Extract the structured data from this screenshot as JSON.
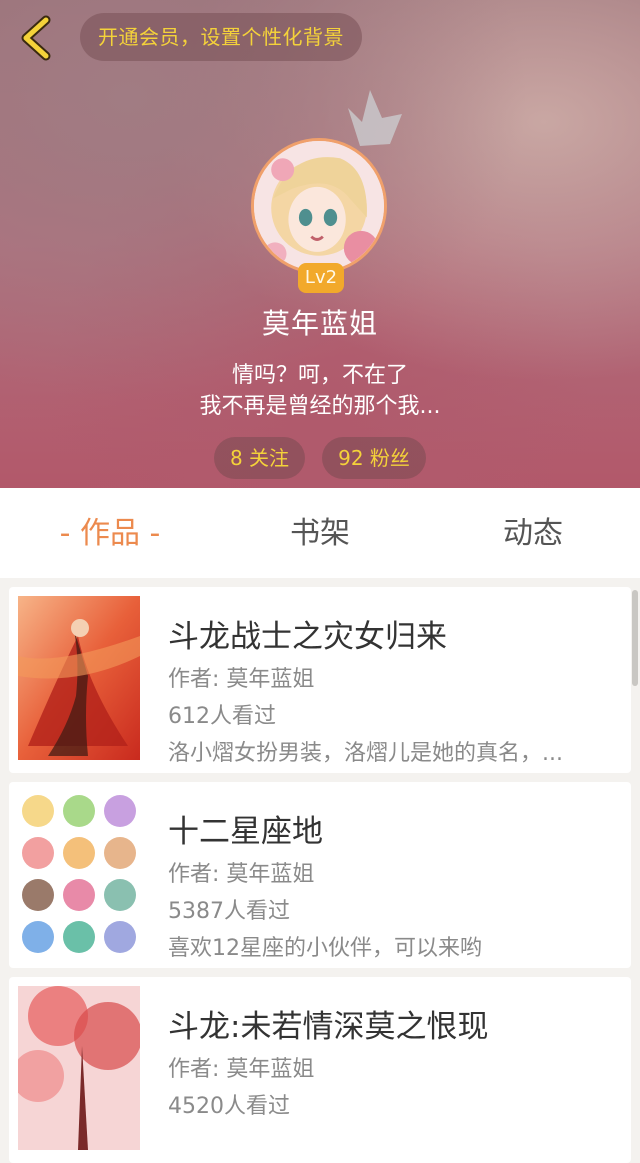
{
  "header": {
    "vip_prompt": "开通会员，设置个性化背景",
    "level": "Lv2",
    "username": "莫年蓝姐",
    "bio_line1": "情吗？呵，不在了",
    "bio_line2": "我不再是曾经的那个我...",
    "following": "8 关注",
    "fans": "92 粉丝"
  },
  "tabs": {
    "works": "- 作品 -",
    "shelf": "书架",
    "feed": "动态"
  },
  "books": [
    {
      "title": "斗龙战士之灾女归来",
      "author": "作者: 莫年蓝姐",
      "views": "612人看过",
      "desc": "洛小熠女扮男装，洛熠儿是她的真名，..."
    },
    {
      "title": "十二星座地",
      "author": "作者: 莫年蓝姐",
      "views": "5387人看过",
      "desc": "喜欢12星座的小伙伴，可以来哟"
    },
    {
      "title": "斗龙:未若情深莫之恨现",
      "author": "作者: 莫年蓝姐",
      "views": "4520人看过",
      "desc": ""
    }
  ],
  "colors": {
    "accent": "#ec8a4e",
    "gold_text": "#f4d23a",
    "badge": "#f2a92b"
  }
}
